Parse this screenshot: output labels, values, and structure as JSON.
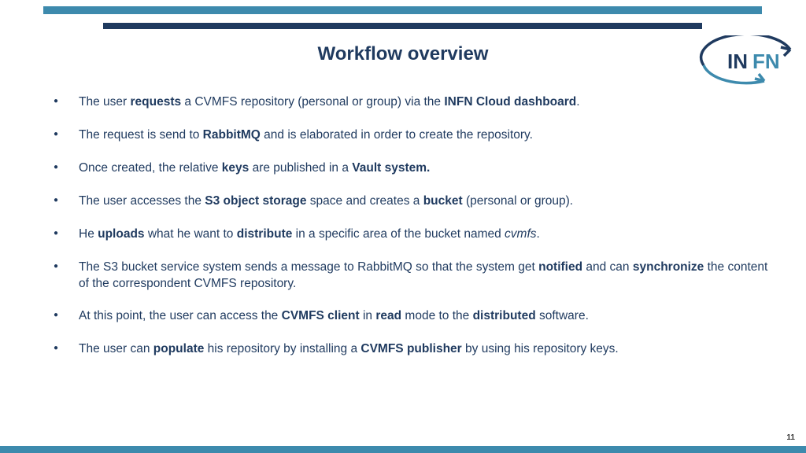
{
  "title": "Workflow overview",
  "logo_text1": "IN",
  "logo_text2": "FN",
  "bullets": [
    "The user <b>requests</b> a CVMFS repository (personal or group) via the <b>INFN Cloud dashboard</b>.",
    "The request is send to <b>RabbitMQ</b> and is elaborated in order to create the repository.",
    "Once created, the relative <b>keys</b> are published in a <b>Vault system.</b>",
    "The user accesses the <b>S3 object storage</b> space and creates a <b>bucket</b> (personal or group).",
    "He <b>uploads</b> what he want to <b>distribute</b> in a specific area of the bucket named <i>cvmfs</i>.",
    "The S3 bucket service system sends a message to RabbitMQ so that the system get <b>notified</b> and can <b>synchronize</b> the content of the correspondent CVMFS repository.",
    "At this point, the user can access the <b>CVMFS client</b> in <b>read</b> mode to the <b>distributed</b> software.",
    "The user can <b>populate</b> his repository by installing a <b>CVMFS publisher</b> by using his repository keys."
  ],
  "page_number": "11"
}
